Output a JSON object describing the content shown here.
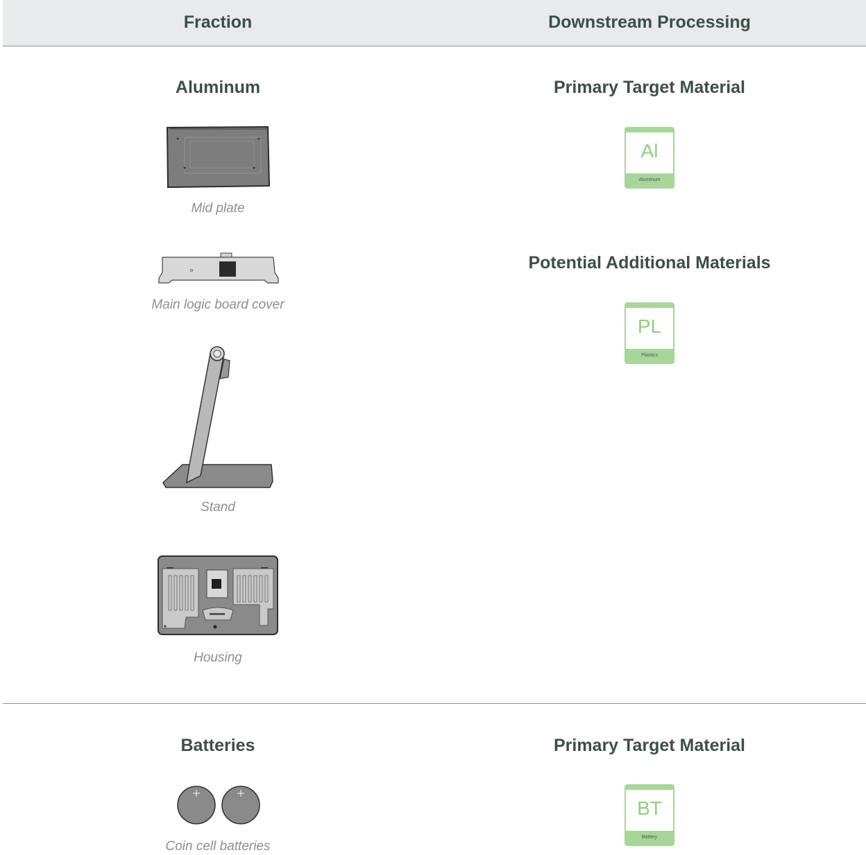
{
  "header": {
    "fraction": "Fraction",
    "downstream": "Downstream Processing"
  },
  "sections": [
    {
      "fraction_title": "Aluminum",
      "items": [
        {
          "caption": "Mid plate",
          "icon": "mid-plate-illustration"
        },
        {
          "caption": "Main logic board cover",
          "icon": "logic-board-cover-illustration"
        },
        {
          "caption": "Stand",
          "icon": "stand-illustration"
        },
        {
          "caption": "Housing",
          "icon": "housing-illustration"
        }
      ],
      "primary_heading": "Primary Target Material",
      "primary_material": {
        "symbol": "Al",
        "name": "Aluminum"
      },
      "additional_heading": "Potential Additional Materials",
      "additional_materials": [
        {
          "symbol": "PL",
          "name": "Plastics"
        }
      ]
    },
    {
      "fraction_title": "Batteries",
      "items": [
        {
          "caption": "Coin cell batteries",
          "icon": "coin-cell-batteries-illustration"
        }
      ],
      "primary_heading": "Primary Target Material",
      "primary_material": {
        "symbol": "BT",
        "name": "Battery"
      }
    }
  ],
  "colors": {
    "header_bg": "#e9eaeb",
    "heading_text": "#3e4e48",
    "caption_text": "#8e8e8e",
    "material_green": "#a7d59a",
    "material_symbol": "#8fcf80"
  }
}
